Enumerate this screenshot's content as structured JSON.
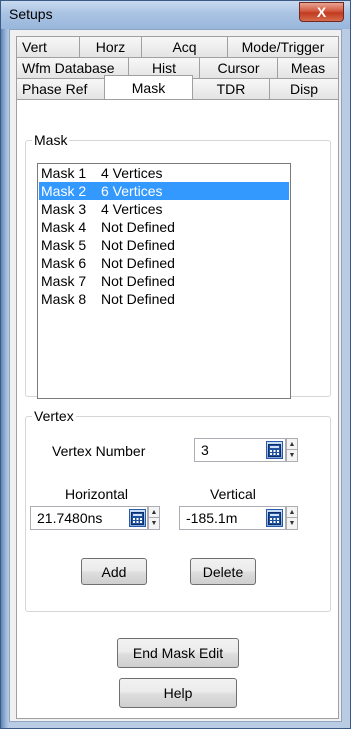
{
  "window": {
    "title": "Setups",
    "close_glyph": "X"
  },
  "tabs": {
    "row1": [
      "Vert",
      "Horz",
      "Acq",
      "Mode/Trigger"
    ],
    "row2": [
      "Wfm Database",
      "Hist",
      "Cursor",
      "Meas"
    ],
    "row3": [
      "Phase Ref",
      "Mask",
      "TDR",
      "Disp"
    ],
    "active": "Mask"
  },
  "mask_group": {
    "title": "Mask",
    "items": [
      {
        "name": "Mask 1",
        "status": "4 Vertices",
        "selected": false
      },
      {
        "name": "Mask 2",
        "status": "6 Vertices",
        "selected": true
      },
      {
        "name": "Mask 3",
        "status": "4 Vertices",
        "selected": false
      },
      {
        "name": "Mask 4",
        "status": "Not Defined",
        "selected": false
      },
      {
        "name": "Mask 5",
        "status": "Not Defined",
        "selected": false
      },
      {
        "name": "Mask 6",
        "status": "Not Defined",
        "selected": false
      },
      {
        "name": "Mask 7",
        "status": "Not Defined",
        "selected": false
      },
      {
        "name": "Mask 8",
        "status": "Not Defined",
        "selected": false
      }
    ]
  },
  "vertex_group": {
    "title": "Vertex",
    "vertex_number_label": "Vertex Number",
    "vertex_number_value": "3",
    "horizontal_label": "Horizontal",
    "horizontal_value": "21.7480ns",
    "vertical_label": "Vertical",
    "vertical_value": "-185.1m",
    "add_label": "Add",
    "delete_label": "Delete"
  },
  "buttons": {
    "end_mask_edit": "End Mask Edit",
    "help": "Help"
  },
  "colors": {
    "selection": "#3399ff",
    "close_button": "#c8442a",
    "title_bar": "#a9c3e3"
  }
}
